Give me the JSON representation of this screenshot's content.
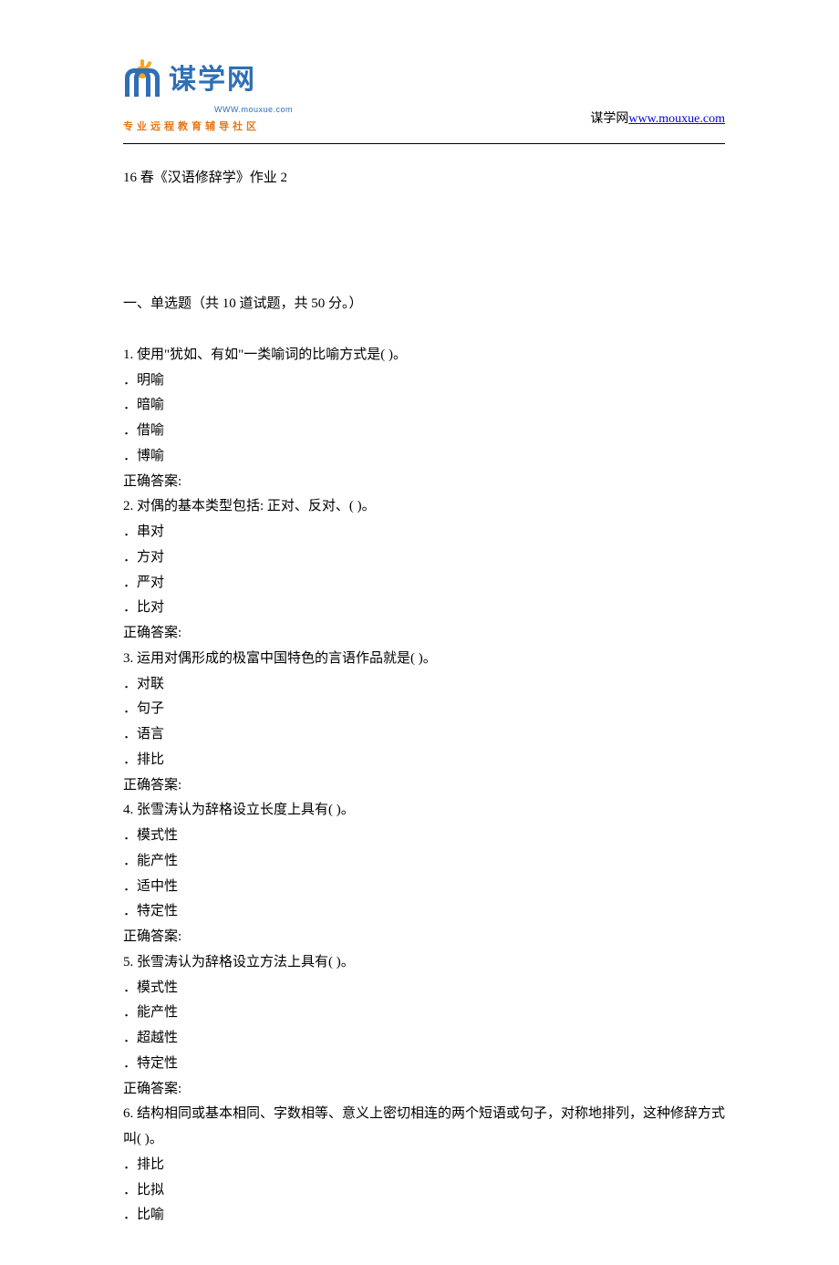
{
  "header": {
    "logo_text": "谋学网",
    "logo_url": "WWW.mouxue.com",
    "logo_tagline": "专业远程教育辅导社区",
    "site_label": "谋学网",
    "site_url": "www.mouxue.com"
  },
  "title": "16 春《汉语修辞学》作业 2",
  "section_header": "一、单选题（共 10 道试题，共 50 分。）",
  "questions": [
    {
      "stem": "1.  使用\"犹如、有如\"一类喻词的比喻方式是( )。",
      "options": [
        "．明喻",
        "．暗喻",
        "．借喻",
        "．博喻"
      ],
      "answer_label": "正确答案:"
    },
    {
      "stem": "2.  对偶的基本类型包括: 正对、反对、( )。",
      "options": [
        "．串对",
        "．方对",
        "．严对",
        "．比对"
      ],
      "answer_label": "正确答案:"
    },
    {
      "stem": "3.  运用对偶形成的极富中国特色的言语作品就是( )。",
      "options": [
        "．对联",
        "．句子",
        "．语言",
        "．排比"
      ],
      "answer_label": "正确答案:"
    },
    {
      "stem": "4.  张雪涛认为辞格设立长度上具有( )。",
      "options": [
        "．模式性",
        "．能产性",
        "．适中性",
        "．特定性"
      ],
      "answer_label": "正确答案:"
    },
    {
      "stem": "5.  张雪涛认为辞格设立方法上具有( )。",
      "options": [
        "．模式性",
        "．能产性",
        "．超越性",
        "．特定性"
      ],
      "answer_label": "正确答案:"
    },
    {
      "stem": "6.  结构相同或基本相同、字数相等、意义上密切相连的两个短语或句子，对称地排列，这种修辞方式叫( )。",
      "options": [
        "．排比",
        "．比拟",
        "．比喻"
      ],
      "answer_label": null
    }
  ]
}
